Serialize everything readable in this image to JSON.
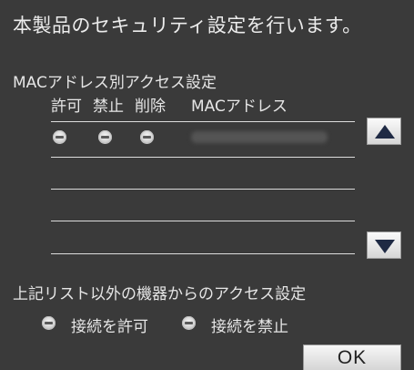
{
  "screen": {
    "title": "本製品のセキュリティ設定を行います。"
  },
  "mac_access": {
    "section_label": "MACアドレス別アクセス設定",
    "headers": {
      "allow": "許可",
      "deny": "禁止",
      "delete": "削除",
      "mac_address": "MACアドレス"
    },
    "rows": [
      {
        "allow": true,
        "deny": false,
        "delete": false,
        "mac_address": ""
      }
    ],
    "scroll_up_icon": "triangle-up-icon",
    "scroll_down_icon": "triangle-down-icon"
  },
  "other_devices": {
    "section_label": "上記リスト以外の機器からのアクセス設定",
    "options": [
      {
        "label": "接続を許可",
        "selected": true
      },
      {
        "label": "接続を禁止",
        "selected": false
      }
    ]
  },
  "footer": {
    "ok_label": "OK"
  },
  "colors": {
    "background": "#3a3a3a",
    "text": "#e6e6e6",
    "button_face": "#e8e8e8"
  }
}
